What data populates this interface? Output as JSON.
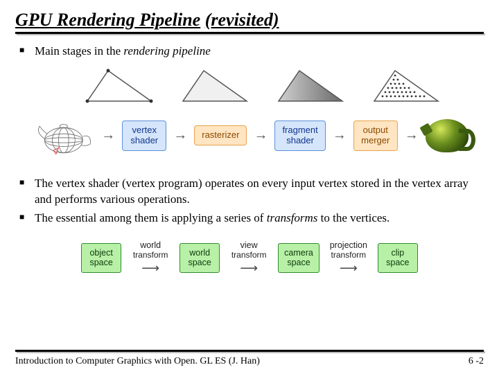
{
  "title_main": "GPU Rendering Pipeline",
  "title_paren": "(revisited)",
  "bullets": {
    "b1_pre": "Main stages in the ",
    "b1_em": "rendering pipeline",
    "b2": "The vertex shader (vertex program) operates on every input vertex stored in the vertex array and performs various operations.",
    "b3_pre": "The essential among them is applying a series of ",
    "b3_em": "transforms",
    "b3_post": " to the vertices."
  },
  "pipeline": {
    "p1a": "vertex",
    "p1b": "shader",
    "p2": "rasterizer",
    "p3a": "fragment",
    "p3b": "shader",
    "p4a": "output",
    "p4b": "merger"
  },
  "transforms": {
    "s1a": "object",
    "s1b": "space",
    "t1a": "world",
    "t1b": "transform",
    "s2a": "world",
    "s2b": "space",
    "t2a": "view",
    "t2b": "transform",
    "s3a": "camera",
    "s3b": "space",
    "t3a": "projection",
    "t3b": "transform",
    "s4a": "clip",
    "s4b": "space"
  },
  "footer": {
    "left": "Introduction to Computer Graphics with Open. GL ES (J. Han)",
    "right": "6 -2"
  }
}
